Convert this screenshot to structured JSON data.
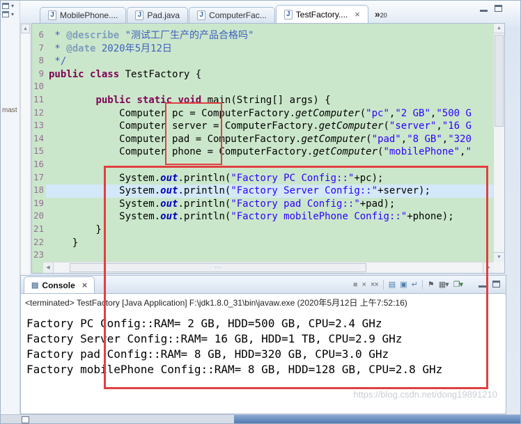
{
  "tabs": [
    {
      "label": "MobilePhone....",
      "active": false
    },
    {
      "label": "Pad.java",
      "active": false
    },
    {
      "label": "ComputerFac...",
      "active": false
    },
    {
      "label": "TestFactory....",
      "active": true
    }
  ],
  "tab_overflow": {
    "chevron": "»",
    "count": "20"
  },
  "left_strip": {
    "label": "mast"
  },
  "editor": {
    "lines": [
      {
        "n": "6",
        "parts": [
          [
            "c",
            " * "
          ],
          [
            "t",
            "@describe"
          ],
          [
            "c",
            " \"测试工厂生产的产品合格吗\""
          ]
        ]
      },
      {
        "n": "7",
        "parts": [
          [
            "c",
            " * "
          ],
          [
            "t",
            "@date"
          ],
          [
            "c",
            " 2020年5月12日"
          ]
        ]
      },
      {
        "n": "8",
        "parts": [
          [
            "c",
            " */"
          ]
        ]
      },
      {
        "n": "9",
        "parts": [
          [
            "k",
            "public"
          ],
          [
            "d",
            " "
          ],
          [
            "k",
            "class"
          ],
          [
            "d",
            " TestFactory {"
          ]
        ]
      },
      {
        "n": "10",
        "parts": []
      },
      {
        "n": "11",
        "parts": [
          [
            "d",
            "        "
          ],
          [
            "k",
            "public"
          ],
          [
            "d",
            " "
          ],
          [
            "k",
            "static"
          ],
          [
            "d",
            " "
          ],
          [
            "k",
            "void"
          ],
          [
            "d",
            " main(String[] args) {"
          ]
        ]
      },
      {
        "n": "12",
        "parts": [
          [
            "d",
            "            Computer pc = ComputerFactory."
          ],
          [
            "m",
            "getComputer"
          ],
          [
            "d",
            "("
          ],
          [
            "s",
            "\"pc\""
          ],
          [
            "d",
            ","
          ],
          [
            "s",
            "\"2 GB\""
          ],
          [
            "d",
            ","
          ],
          [
            "s",
            "\"500 G"
          ]
        ]
      },
      {
        "n": "13",
        "parts": [
          [
            "d",
            "            Computer server = ComputerFactory."
          ],
          [
            "m",
            "getComputer"
          ],
          [
            "d",
            "("
          ],
          [
            "s",
            "\"server\""
          ],
          [
            "d",
            ","
          ],
          [
            "s",
            "\"16 G"
          ]
        ]
      },
      {
        "n": "14",
        "parts": [
          [
            "d",
            "            Computer pad = ComputerFactory."
          ],
          [
            "m",
            "getComputer"
          ],
          [
            "d",
            "("
          ],
          [
            "s",
            "\"pad\""
          ],
          [
            "d",
            ","
          ],
          [
            "s",
            "\"8 GB\""
          ],
          [
            "d",
            ","
          ],
          [
            "s",
            "\"320"
          ]
        ]
      },
      {
        "n": "15",
        "parts": [
          [
            "d",
            "            Computer phone = ComputerFactory."
          ],
          [
            "m",
            "getComputer"
          ],
          [
            "d",
            "("
          ],
          [
            "s",
            "\"mobilePhone\""
          ],
          [
            "d",
            ","
          ],
          [
            "s",
            "\""
          ]
        ]
      },
      {
        "n": "16",
        "parts": []
      },
      {
        "n": "17",
        "parts": [
          [
            "d",
            "            System."
          ],
          [
            "f",
            "out"
          ],
          [
            "d",
            ".println("
          ],
          [
            "s",
            "\"Factory PC Config::\""
          ],
          [
            "d",
            "+pc);"
          ]
        ]
      },
      {
        "n": "18",
        "hl": true,
        "parts": [
          [
            "d",
            "            System."
          ],
          [
            "f",
            "out"
          ],
          [
            "d",
            ".println("
          ],
          [
            "s",
            "\"Factory Server Config::\""
          ],
          [
            "d",
            "+server);"
          ]
        ]
      },
      {
        "n": "19",
        "parts": [
          [
            "d",
            "            System."
          ],
          [
            "f",
            "out"
          ],
          [
            "d",
            ".println("
          ],
          [
            "s",
            "\"Factory pad Config::\""
          ],
          [
            "d",
            "+pad);"
          ]
        ]
      },
      {
        "n": "20",
        "parts": [
          [
            "d",
            "            System."
          ],
          [
            "f",
            "out"
          ],
          [
            "d",
            ".println("
          ],
          [
            "s",
            "\"Factory mobilePhone Config::\""
          ],
          [
            "d",
            "+phone);"
          ]
        ]
      },
      {
        "n": "21",
        "parts": [
          [
            "d",
            "        }"
          ]
        ]
      },
      {
        "n": "22",
        "parts": [
          [
            "d",
            "    }"
          ]
        ]
      },
      {
        "n": "23",
        "parts": []
      }
    ]
  },
  "console": {
    "tab_label": "Console",
    "status": "<terminated> TestFactory [Java Application] F:\\jdk1.8.0_31\\bin\\javaw.exe (2020年5月12日 上午7:52:16)",
    "output": [
      "Factory PC Config::RAM= 2 GB, HDD=500 GB, CPU=2.4 GHz",
      "Factory Server Config::RAM= 16 GB, HDD=1 TB, CPU=2.9 GHz",
      "Factory pad Config::RAM= 8 GB, HDD=320 GB, CPU=3.0 GHz",
      "Factory mobilePhone Config::RAM= 8 GB, HDD=128 GB, CPU=2.8 GHz"
    ],
    "toolbar": [
      {
        "name": "terminate-icon",
        "glyph": "■",
        "color": "#9AA0A6"
      },
      {
        "name": "remove-launch-icon",
        "glyph": "×",
        "color": "#5F6368"
      },
      {
        "name": "remove-all-launches-icon",
        "glyph": "××",
        "color": "#5F6368"
      },
      {
        "name": "sep"
      },
      {
        "name": "clear-console-icon",
        "glyph": "▤",
        "color": "#4A7CB0"
      },
      {
        "name": "scroll-lock-icon",
        "glyph": "▣",
        "color": "#4A7CB0"
      },
      {
        "name": "word-wrap-icon",
        "glyph": "↵",
        "color": "#4A7CB0"
      },
      {
        "name": "sep"
      },
      {
        "name": "pin-console-icon",
        "glyph": "⚑",
        "color": "#5F6368"
      },
      {
        "name": "display-selected-console-icon",
        "glyph": "▦▾",
        "color": "#5F6368"
      },
      {
        "name": "open-console-icon",
        "glyph": "❐▾",
        "color": "#3C7A3C"
      }
    ]
  },
  "watermark": "https://blog.csdn.net/dong19891210",
  "colors": {
    "editor_bg": "#CBE7CB",
    "keyword": "#7F0055",
    "string": "#2A00FF",
    "javadoc": "#3F5FBF",
    "current_line": "#D3E8F8",
    "annotation_red": "#E04040"
  }
}
